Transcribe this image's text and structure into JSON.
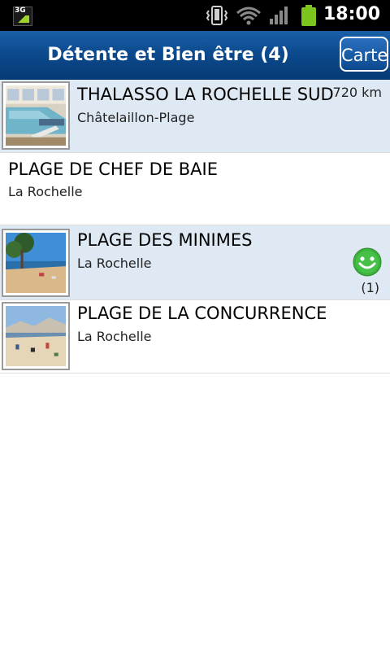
{
  "status_bar": {
    "network_label": "3G",
    "time": "18:00",
    "icons": [
      "3g-icon",
      "vibrate-icon",
      "wifi-icon",
      "signal-icon",
      "battery-icon"
    ]
  },
  "title_bar": {
    "title": "Détente et Bien être (4)",
    "map_button": "Carte"
  },
  "items": [
    {
      "name": "THALASSO LA ROCHELLE SUD",
      "city": "Châtelaillon-Plage",
      "distance": "720 km",
      "has_thumb": true,
      "highlighted": true
    },
    {
      "name": "PLAGE DE CHEF DE BAIE",
      "city": "La Rochelle",
      "has_thumb": false,
      "highlighted": false
    },
    {
      "name": "PLAGE DES MINIMES",
      "city": "La Rochelle",
      "rating_count": "(1)",
      "has_thumb": true,
      "highlighted": true
    },
    {
      "name": "PLAGE DE LA CONCURRENCE",
      "city": "La Rochelle",
      "has_thumb": true,
      "highlighted": false
    }
  ],
  "colors": {
    "title_bar": "#0c4a8e",
    "highlight_row": "#dfe9f3",
    "smiley": "#3cb33c"
  }
}
